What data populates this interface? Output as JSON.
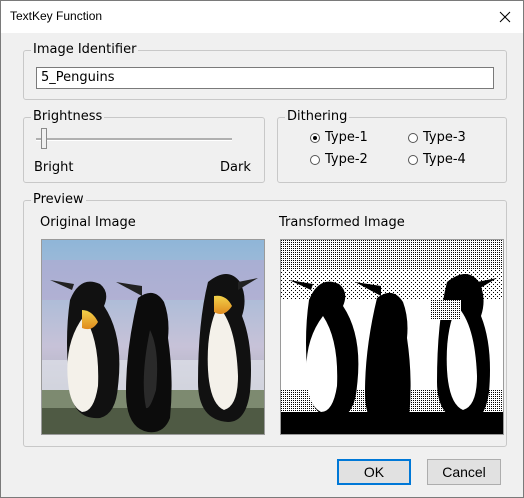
{
  "window": {
    "title": "TextKey Function",
    "close_glyph": "✕"
  },
  "image_identifier": {
    "label": "Image Identifier",
    "value": "5_Penguins"
  },
  "brightness": {
    "label": "Brightness",
    "min_label": "Bright",
    "max_label": "Dark",
    "level": 0.1
  },
  "dithering": {
    "label": "Dithering",
    "options": [
      {
        "label": "Type-1",
        "checked": true
      },
      {
        "label": "Type-3",
        "checked": false
      },
      {
        "label": "Type-2",
        "checked": false
      },
      {
        "label": "Type-4",
        "checked": false
      }
    ]
  },
  "preview": {
    "label": "Preview",
    "original_label": "Original Image",
    "transformed_label": "Transformed Image"
  },
  "buttons": {
    "ok": "OK",
    "cancel": "Cancel"
  },
  "colors": {
    "accent": "#0078d7",
    "dialog_bg": "#f0f0f0"
  },
  "icons": {
    "close": "close-icon",
    "radio": "radio-icon"
  }
}
